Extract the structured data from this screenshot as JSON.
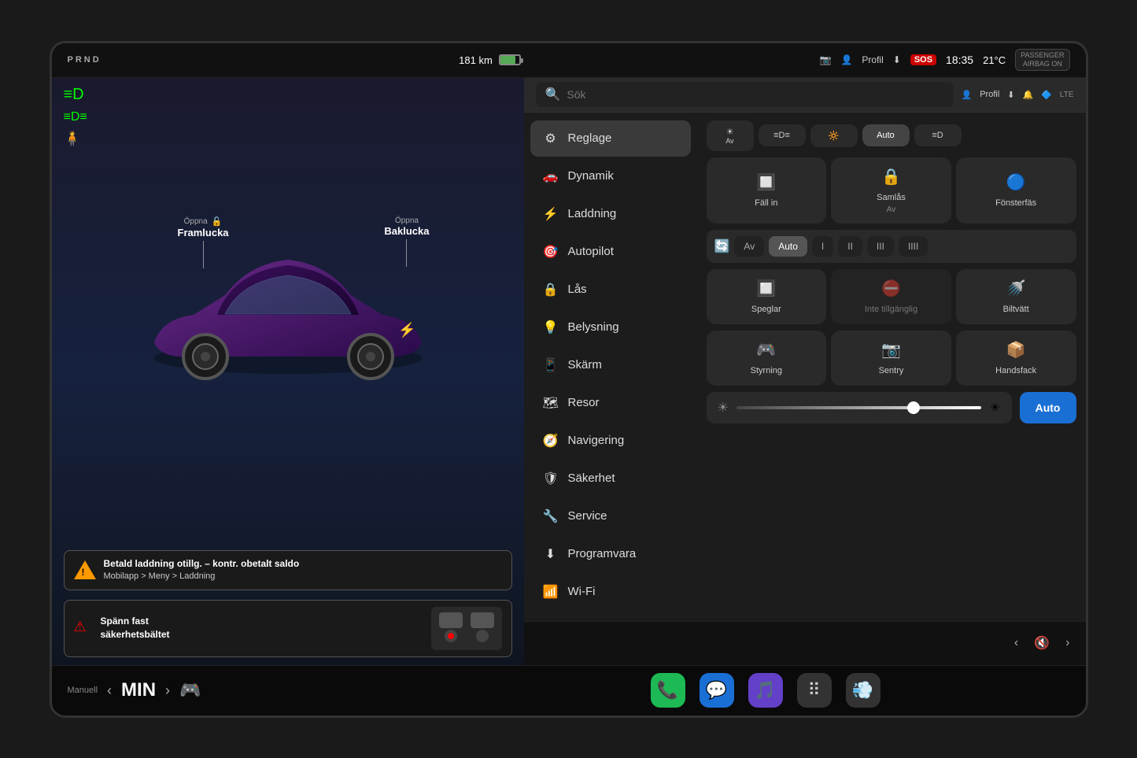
{
  "statusBar": {
    "prnd": "PRND",
    "range": "181 km",
    "profileIcon": "👤",
    "profileLabel": "Profil",
    "downloadIcon": "⬇",
    "sosLabel": "SOS",
    "time": "18:35",
    "temp": "21°C",
    "passengerBadge1": "PASSENGER",
    "passengerBadge2": "AIRBAG ON"
  },
  "searchBar": {
    "placeholder": "Sök",
    "profileLabel": "Profil"
  },
  "carPanel": {
    "labelFramlucka": "Öppna",
    "labelFramluckaBig": "Framlucka",
    "labelBaklucka": "Öppna",
    "labelBakluckaBig": "Baklucka",
    "warningTitle": "Betald laddning otillg. – kontr. obetalt saldo",
    "warningSubtitle": "Mobilapp > Meny > Laddning",
    "seatbeltTitle": "Spänn fast",
    "seatbeltSubtitle": "säkerhetsbältet"
  },
  "menuItems": [
    {
      "id": "reglage",
      "icon": "⚙",
      "label": "Reglage",
      "active": true
    },
    {
      "id": "dynamik",
      "icon": "🚗",
      "label": "Dynamik",
      "active": false
    },
    {
      "id": "laddning",
      "icon": "⚡",
      "label": "Laddning",
      "active": false
    },
    {
      "id": "autopilot",
      "icon": "🎯",
      "label": "Autopilot",
      "active": false
    },
    {
      "id": "las",
      "icon": "🔒",
      "label": "Lås",
      "active": false
    },
    {
      "id": "belysning",
      "icon": "💡",
      "label": "Belysning",
      "active": false
    },
    {
      "id": "skarm",
      "icon": "📱",
      "label": "Skärm",
      "active": false
    },
    {
      "id": "resor",
      "icon": "🗺",
      "label": "Resor",
      "active": false
    },
    {
      "id": "navigering",
      "icon": "🧭",
      "label": "Navigering",
      "active": false
    },
    {
      "id": "sakerhet",
      "icon": "🛡",
      "label": "Säkerhet",
      "active": false
    },
    {
      "id": "service",
      "icon": "🔧",
      "label": "Service",
      "active": false
    },
    {
      "id": "programvara",
      "icon": "⬇",
      "label": "Programvara",
      "active": false
    },
    {
      "id": "wifi",
      "icon": "📶",
      "label": "Wi-Fi",
      "active": false
    }
  ],
  "controls": {
    "lightingRow": {
      "av": "Av",
      "fog": "≡",
      "high": "🔆",
      "auto": "Auto",
      "beam": "≡"
    },
    "controlCards": [
      {
        "id": "fallin",
        "icon": "🔲",
        "label": "Fäll in",
        "sub": ""
      },
      {
        "id": "samlas",
        "icon": "🔒",
        "label": "Samlås",
        "sub": "Av"
      },
      {
        "id": "fonsterfas",
        "icon": "🔵",
        "label": "Fönsterfäs",
        "sub": ""
      }
    ],
    "wiperRow": {
      "icon": "🔄",
      "av": "Av",
      "auto": "Auto",
      "speed1": "I",
      "speed2": "II",
      "speed3": "III",
      "speed4": "IIII"
    },
    "mirrorCards": [
      {
        "id": "speglar",
        "icon": "🔲",
        "label": "Speglar",
        "sub": ""
      },
      {
        "id": "inte",
        "icon": "📵",
        "label": "Inte tillgänglig",
        "sub": ""
      },
      {
        "id": "bilatv",
        "icon": "🚗",
        "label": "Biltvätt",
        "sub": ""
      }
    ],
    "bottomCards": [
      {
        "id": "styrning",
        "icon": "🎯",
        "label": "Styrning",
        "sub": ""
      },
      {
        "id": "sentry",
        "icon": "📷",
        "label": "Sentry",
        "sub": ""
      },
      {
        "id": "handsfack",
        "icon": "📦",
        "label": "Handsfack",
        "sub": ""
      }
    ],
    "autoBtn": "Auto"
  },
  "taskbar": {
    "tempControl": "Manuell",
    "tempValue": "MIN",
    "icons": [
      "📞",
      "💬",
      "🎵",
      "⠿",
      "💨"
    ]
  }
}
